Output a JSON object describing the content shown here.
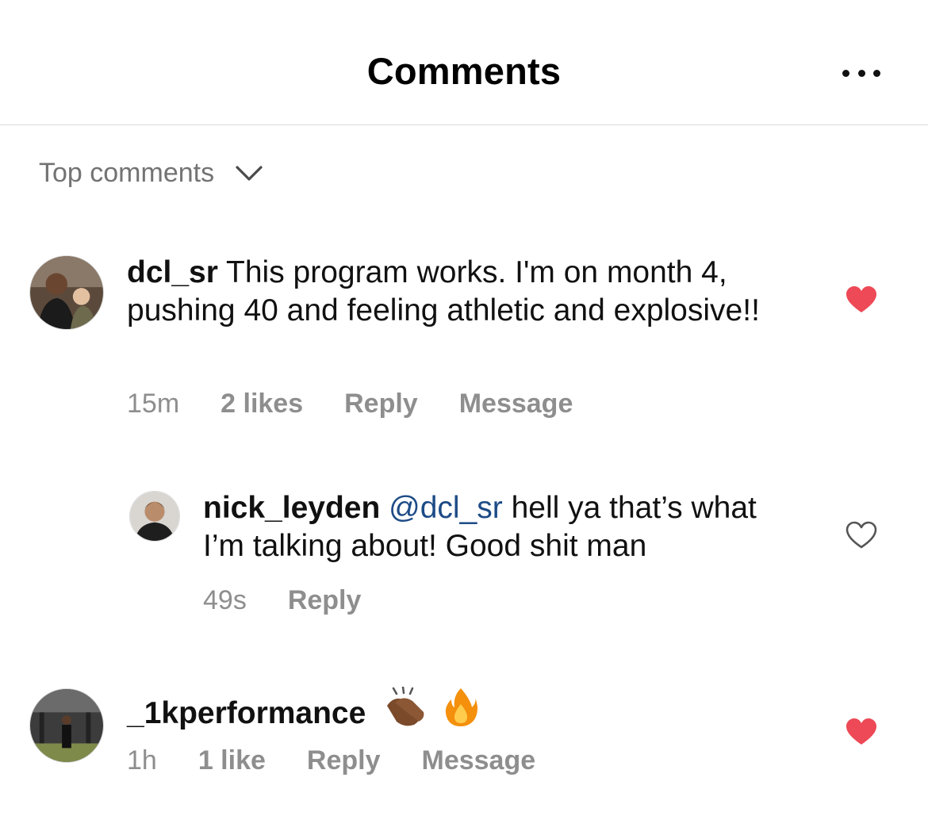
{
  "header": {
    "title": "Comments",
    "more_icon": "more-horizontal-icon"
  },
  "sort": {
    "label": "Top comments",
    "icon": "chevron-down-icon"
  },
  "comments": [
    {
      "username": "dcl_sr",
      "text": " This program works. I'm on month 4, pushing 40 and feeling athletic and explosive!!",
      "time": "15m",
      "likes": "2 likes",
      "reply": "Reply",
      "message": "Message",
      "liked": true
    },
    {
      "username": "nick_leyden",
      "mention": "@dcl_sr",
      "text": " hell ya that’s what I’m talking about! Good shit man",
      "time": "49s",
      "reply": "Reply",
      "liked": false
    },
    {
      "username": "_1kperformance",
      "emojis": [
        "clapping-hands-emoji",
        "fire-emoji"
      ],
      "time": "1h",
      "likes": "1 like",
      "reply": "Reply",
      "message": "Message",
      "liked": true
    }
  ],
  "colors": {
    "heart_filled": "#ed4956",
    "secondary_text": "#8e8e8e",
    "mention": "#1d4b86",
    "divider": "#dbdbdb"
  }
}
